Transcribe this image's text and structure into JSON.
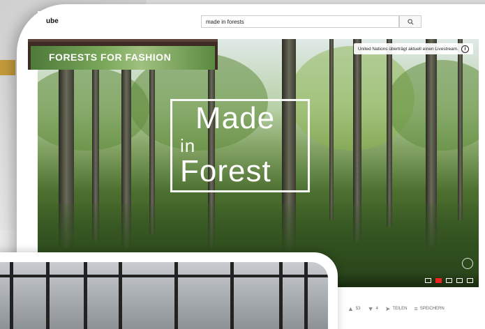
{
  "topbar": {
    "logo_fragment": "ube",
    "search_value": "made in forests"
  },
  "player": {
    "notice": "United Nations überträgt aktuell einen Livestream.",
    "overlay_title": [
      "Made",
      "in",
      "Forest"
    ]
  },
  "actions": {
    "likes": "53",
    "dislikes": "4",
    "share_label": "TEILEN",
    "save_label": "SPEICHERN"
  },
  "banner": {
    "title": "FORESTS FOR FASHION"
  },
  "colors": {
    "accent_gold": "#c49a3a",
    "control_red": "#e22222"
  },
  "icons": {
    "search": "search-icon",
    "info": "info-icon",
    "like": "thumbs-up-icon",
    "dislike": "thumbs-down-icon",
    "share": "share-icon",
    "save": "playlist-add-icon"
  }
}
